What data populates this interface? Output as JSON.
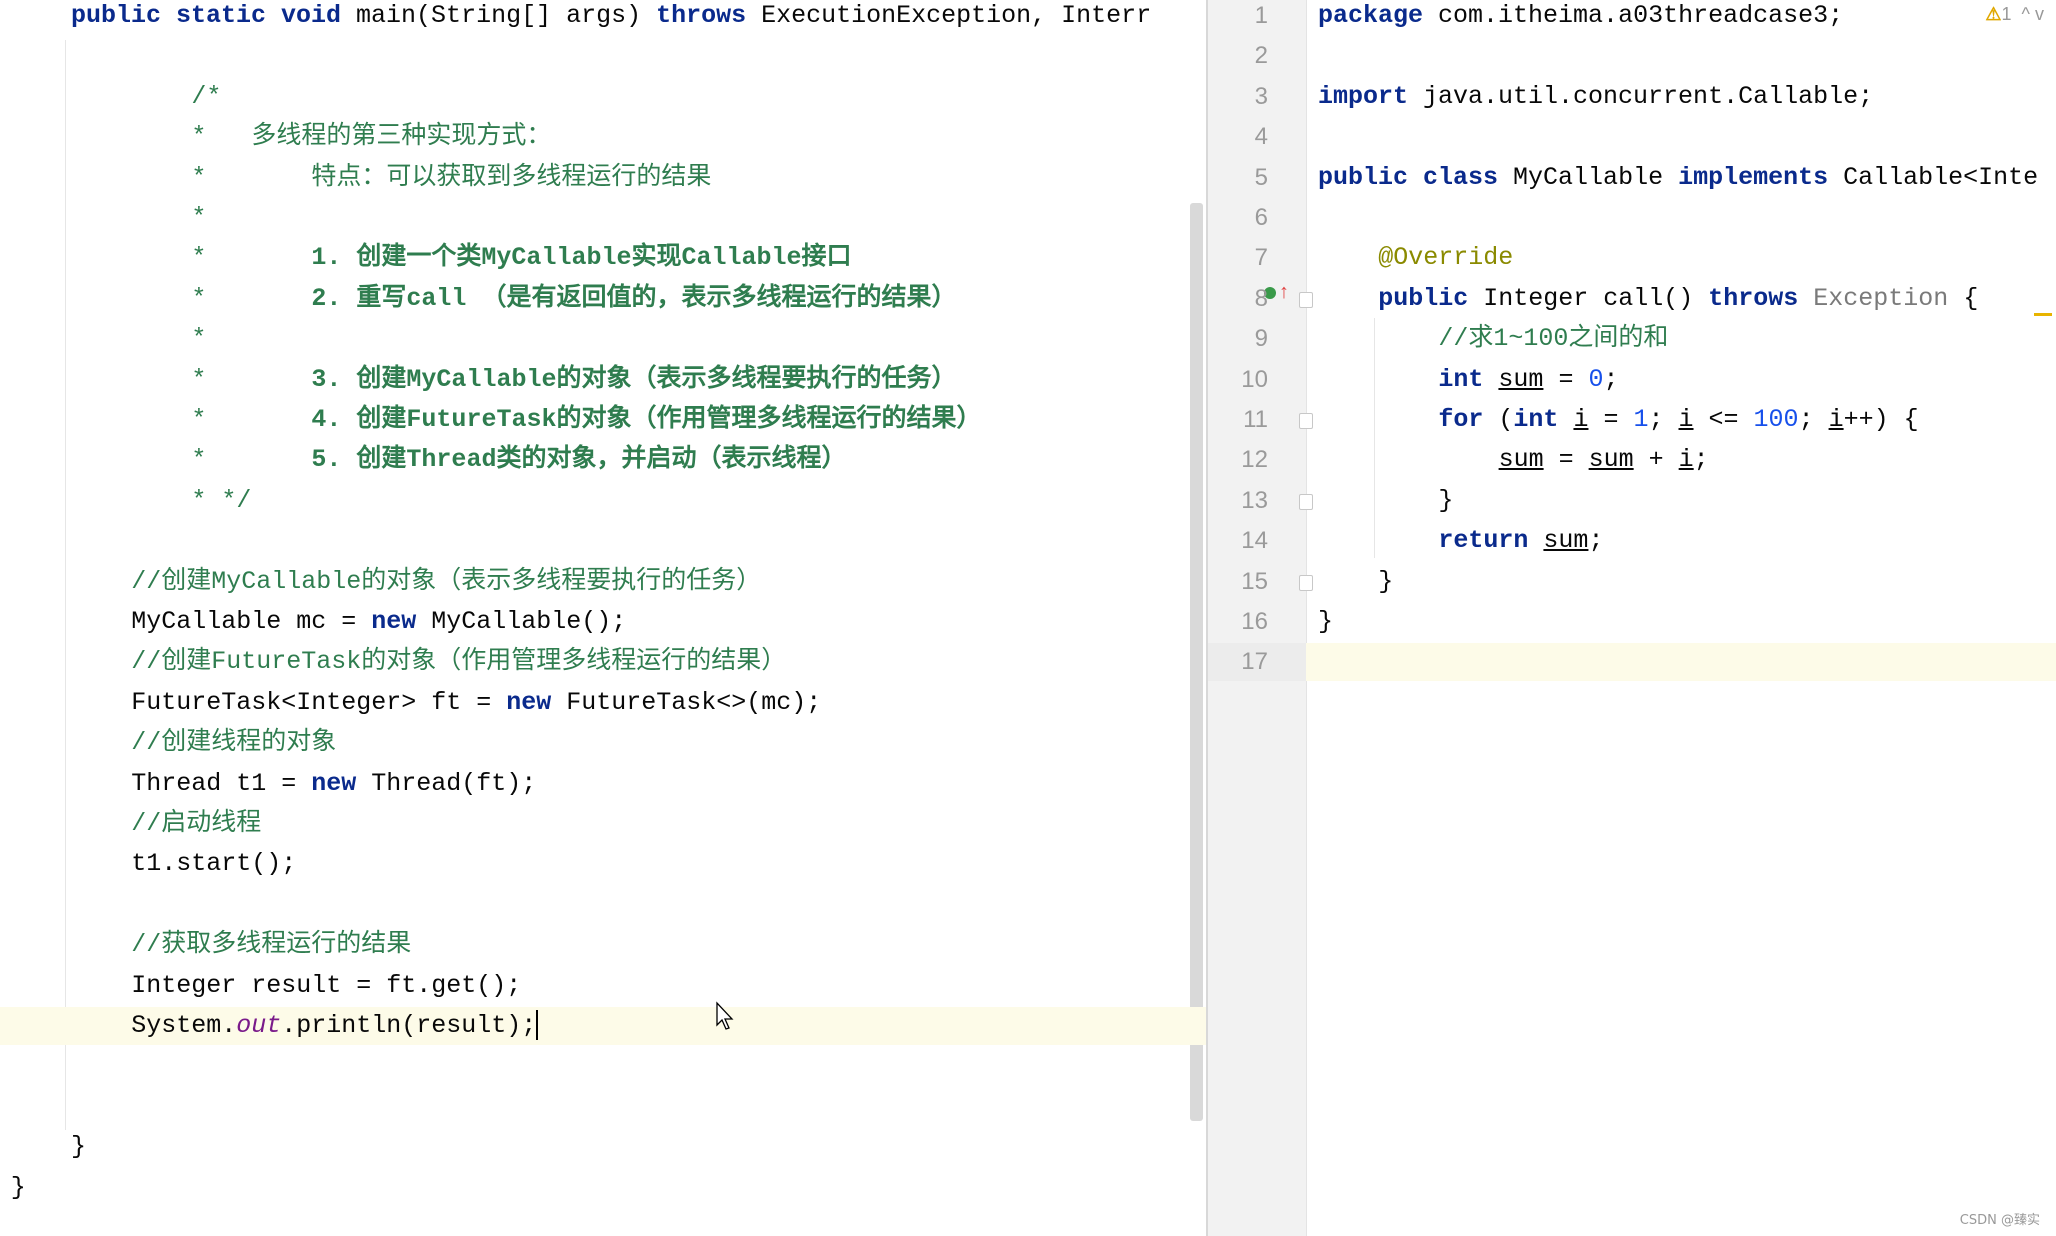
{
  "left_editor": {
    "highlight_line": 25,
    "lines": [
      {
        "indent": 0,
        "tokens": [
          [
            "public static void ",
            "kw"
          ],
          [
            "main(String[] args) ",
            ""
          ],
          [
            "throws",
            "kw"
          ],
          [
            " ExecutionException, Interr",
            ""
          ]
        ]
      },
      {
        "indent": 0,
        "tokens": []
      },
      {
        "indent": 8,
        "tokens": [
          [
            "/*",
            "cm"
          ]
        ]
      },
      {
        "indent": 8,
        "tokens": [
          [
            "*   多线程的第三种实现方式：",
            "cm"
          ]
        ]
      },
      {
        "indent": 8,
        "tokens": [
          [
            "*       特点：可以获取到多线程运行的结果",
            "cm"
          ]
        ]
      },
      {
        "indent": 8,
        "tokens": [
          [
            "*",
            "cm"
          ]
        ]
      },
      {
        "indent": 8,
        "tokens": [
          [
            "*       ",
            "cm"
          ],
          [
            "1. 创建一个类MyCallable实现Callable接口",
            "cmb"
          ]
        ]
      },
      {
        "indent": 8,
        "tokens": [
          [
            "*       ",
            "cm"
          ],
          [
            "2. 重写call （是有返回值的，表示多线程运行的结果）",
            "cmb"
          ]
        ]
      },
      {
        "indent": 8,
        "tokens": [
          [
            "*",
            "cm"
          ]
        ]
      },
      {
        "indent": 8,
        "tokens": [
          [
            "*       ",
            "cm"
          ],
          [
            "3. 创建MyCallable的对象（表示多线程要执行的任务）",
            "cmb"
          ]
        ]
      },
      {
        "indent": 8,
        "tokens": [
          [
            "*       ",
            "cm"
          ],
          [
            "4. 创建FutureTask的对象（作用管理多线程运行的结果）",
            "cmb"
          ]
        ]
      },
      {
        "indent": 8,
        "tokens": [
          [
            "*       ",
            "cm"
          ],
          [
            "5. 创建Thread类的对象，并启动（表示线程）",
            "cmb"
          ]
        ]
      },
      {
        "indent": 8,
        "tokens": [
          [
            "* */",
            "cm"
          ]
        ]
      },
      {
        "indent": 0,
        "tokens": []
      },
      {
        "indent": 4,
        "tokens": [
          [
            "//创建MyCallable的对象（表示多线程要执行的任务）",
            "cm"
          ]
        ]
      },
      {
        "indent": 4,
        "tokens": [
          [
            "MyCallable mc = ",
            ""
          ],
          [
            "new",
            "kw"
          ],
          [
            " MyCallable();",
            ""
          ]
        ]
      },
      {
        "indent": 4,
        "tokens": [
          [
            "//创建FutureTask的对象（作用管理多线程运行的结果）",
            "cm"
          ]
        ]
      },
      {
        "indent": 4,
        "tokens": [
          [
            "FutureTask<Integer> ft = ",
            ""
          ],
          [
            "new",
            "kw"
          ],
          [
            " FutureTask<>(mc);",
            ""
          ]
        ]
      },
      {
        "indent": 4,
        "tokens": [
          [
            "//创建线程的对象",
            "cm"
          ]
        ]
      },
      {
        "indent": 4,
        "tokens": [
          [
            "Thread t1 = ",
            ""
          ],
          [
            "new",
            "kw"
          ],
          [
            " Thread(ft);",
            ""
          ]
        ]
      },
      {
        "indent": 4,
        "tokens": [
          [
            "//启动线程",
            "cm"
          ]
        ]
      },
      {
        "indent": 4,
        "tokens": [
          [
            "t1.start();",
            ""
          ]
        ]
      },
      {
        "indent": 0,
        "tokens": []
      },
      {
        "indent": 4,
        "tokens": [
          [
            "//获取多线程运行的结果",
            "cm"
          ]
        ]
      },
      {
        "indent": 4,
        "tokens": [
          [
            "Integer result = ft.get();",
            ""
          ]
        ]
      },
      {
        "indent": 4,
        "tokens": [
          [
            "System.",
            ""
          ],
          [
            "out",
            "it"
          ],
          [
            ".println(result);",
            ""
          ]
        ]
      },
      {
        "indent": 0,
        "tokens": []
      },
      {
        "indent": 0,
        "tokens": []
      },
      {
        "indent": 0,
        "tokens": [
          [
            "}",
            ""
          ]
        ]
      },
      {
        "indent": -4,
        "tokens": [
          [
            "}",
            ""
          ]
        ]
      }
    ]
  },
  "right_editor": {
    "highlight_line": 16,
    "warning_count": "1",
    "lines": [
      {
        "n": "1",
        "indent": 0,
        "tokens": [
          [
            "package",
            "kw"
          ],
          [
            " com.itheima.a03threadcase3;",
            ""
          ]
        ]
      },
      {
        "n": "2",
        "indent": 0,
        "tokens": []
      },
      {
        "n": "3",
        "indent": 0,
        "tokens": [
          [
            "import",
            "kw"
          ],
          [
            " java.util.concurrent.Callable;",
            ""
          ]
        ]
      },
      {
        "n": "4",
        "indent": 0,
        "tokens": []
      },
      {
        "n": "5",
        "indent": 0,
        "tokens": [
          [
            "public class ",
            "kw"
          ],
          [
            "MyCallable ",
            ""
          ],
          [
            "implements",
            "kw"
          ],
          [
            " Callable<Inte",
            ""
          ]
        ]
      },
      {
        "n": "6",
        "indent": 0,
        "tokens": []
      },
      {
        "n": "7",
        "indent": 4,
        "tokens": [
          [
            "@Override",
            "ann"
          ]
        ]
      },
      {
        "n": "8",
        "indent": 4,
        "tokens": [
          [
            "public",
            "kw"
          ],
          [
            " Integer call() ",
            ""
          ],
          [
            "throws",
            "kw"
          ],
          [
            " ",
            ""
          ],
          [
            "Exception",
            "gr"
          ],
          [
            " {",
            ""
          ]
        ]
      },
      {
        "n": "9",
        "indent": 8,
        "tokens": [
          [
            "//求1~100之间的和",
            "cm"
          ]
        ]
      },
      {
        "n": "10",
        "indent": 8,
        "tokens": [
          [
            "int",
            "kw"
          ],
          [
            " ",
            ""
          ],
          [
            "sum",
            "ul"
          ],
          [
            " = ",
            ""
          ],
          [
            "0",
            "num"
          ],
          [
            ";",
            ""
          ]
        ]
      },
      {
        "n": "11",
        "indent": 8,
        "tokens": [
          [
            "for",
            "kw"
          ],
          [
            " (",
            ""
          ],
          [
            "int",
            "kw"
          ],
          [
            " ",
            ""
          ],
          [
            "i",
            "ul"
          ],
          [
            " = ",
            ""
          ],
          [
            "1",
            "num"
          ],
          [
            "; ",
            ""
          ],
          [
            "i",
            "ul"
          ],
          [
            " <= ",
            ""
          ],
          [
            "100",
            "num"
          ],
          [
            "; ",
            ""
          ],
          [
            "i",
            "ul"
          ],
          [
            "++) {",
            ""
          ]
        ]
      },
      {
        "n": "12",
        "indent": 12,
        "tokens": [
          [
            "sum",
            "ul"
          ],
          [
            " = ",
            ""
          ],
          [
            "sum",
            "ul"
          ],
          [
            " + ",
            ""
          ],
          [
            "i",
            "ul"
          ],
          [
            ";",
            ""
          ]
        ]
      },
      {
        "n": "13",
        "indent": 8,
        "tokens": [
          [
            "}",
            ""
          ]
        ]
      },
      {
        "n": "14",
        "indent": 8,
        "tokens": [
          [
            "return",
            "kw"
          ],
          [
            " ",
            ""
          ],
          [
            "sum",
            "ul"
          ],
          [
            ";",
            ""
          ]
        ]
      },
      {
        "n": "15",
        "indent": 4,
        "tokens": [
          [
            "}",
            ""
          ]
        ]
      },
      {
        "n": "16",
        "indent": 0,
        "tokens": [
          [
            "}",
            ""
          ]
        ]
      },
      {
        "n": "17",
        "indent": 0,
        "tokens": []
      }
    ]
  },
  "icons": {
    "warning": "warning-triangle-icon",
    "prev": "chevron-up-icon",
    "next": "chevron-down-icon",
    "implements": "implements-method-icon"
  },
  "indicator": {
    "up": "^",
    "down": "v",
    "warn_glyph": "⚠"
  },
  "watermark": "CSDN @臻实"
}
